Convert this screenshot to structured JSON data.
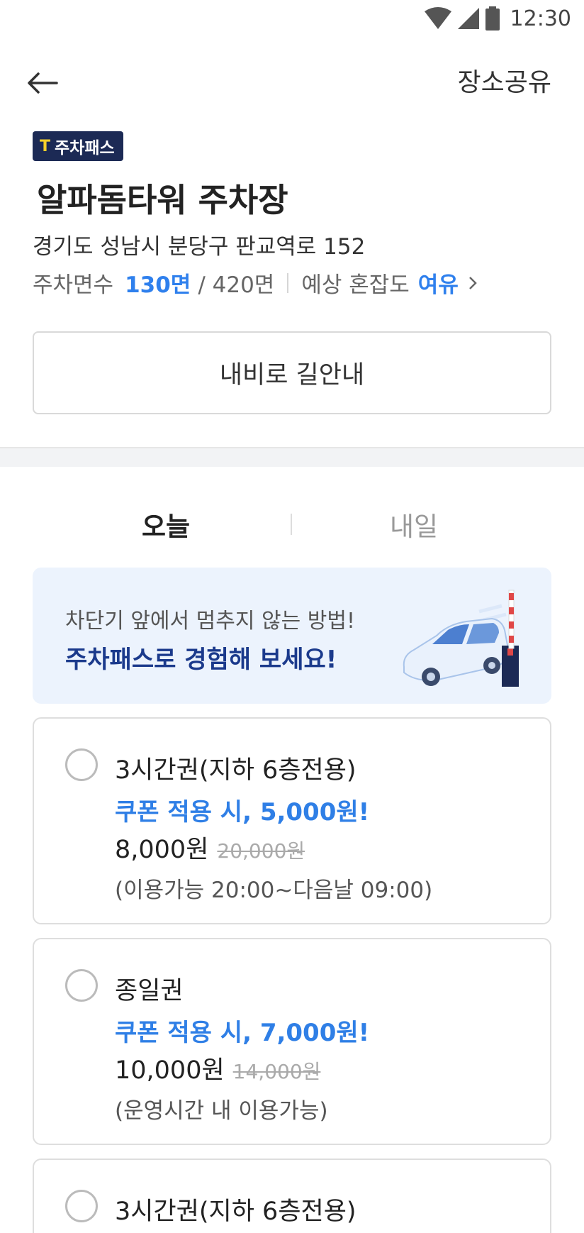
{
  "status": {
    "time": "12:30"
  },
  "header": {
    "share_label": "장소공유"
  },
  "place": {
    "badge_label": "주차패스",
    "badge_icon": "T",
    "name": "알파돔타워 주차장",
    "address": "경기도 성남시 분당구 판교역로 152",
    "spaces_label": "주차면수",
    "spaces_available": "130면",
    "spaces_total": "/ 420면",
    "congestion_label": "예상 혼잡도",
    "congestion_value": "여유"
  },
  "nav_button_label": "내비로 길안내",
  "tabs": [
    {
      "label": "오늘",
      "active": true
    },
    {
      "label": "내일",
      "active": false
    }
  ],
  "promo": {
    "subtitle": "차단기 앞에서 멈추지 않는 방법!",
    "title": "주차패스로 경험해 보세요!"
  },
  "tickets": [
    {
      "name": "3시간권(지하 6층전용)",
      "coupon": "쿠폰 적용 시, 5,000원!",
      "price": "8,000원",
      "original_price": "20,000원",
      "hours": "(이용가능 20:00~다음날 09:00)"
    },
    {
      "name": "종일권",
      "coupon": "쿠폰 적용 시, 7,000원!",
      "price": "10,000원",
      "original_price": "14,000원",
      "hours": "(운영시간 내 이용가능)"
    },
    {
      "name": "3시간권(지하 6층전용)"
    }
  ],
  "colors": {
    "accent_blue": "#2f80ed",
    "badge_navy": "#1c2a55",
    "promo_bg": "#ecf3fd",
    "promo_text": "#1b3a8c"
  }
}
